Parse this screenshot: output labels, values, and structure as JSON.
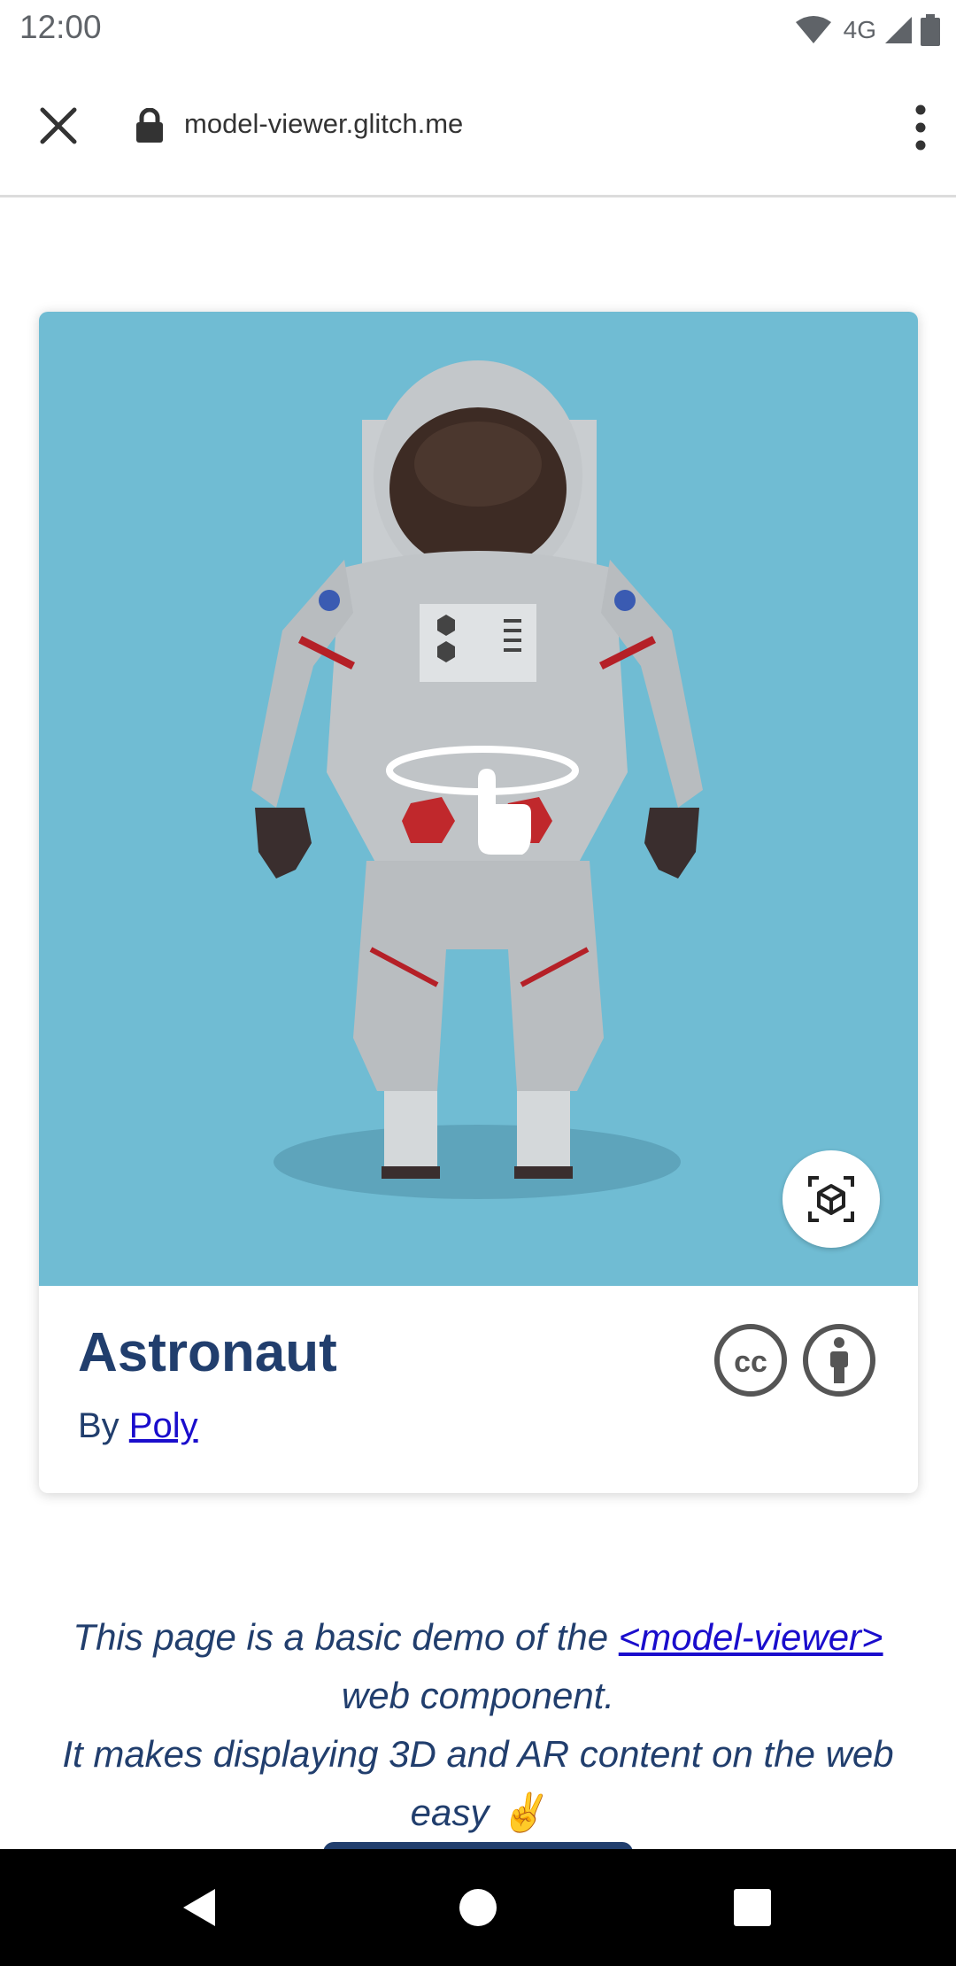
{
  "status_bar": {
    "time": "12:00",
    "network": "4G"
  },
  "browser": {
    "url": "model-viewer.glitch.me"
  },
  "card": {
    "title": "Astronaut",
    "by_prefix": "By ",
    "author": "Poly",
    "background_color": "#70bcd3"
  },
  "description": {
    "part1": "This page is a basic demo of the ",
    "link": "<model-viewer>",
    "part2": " web component.",
    "line2": "It makes displaying 3D and AR content on the web easy ",
    "emoji": "✌️"
  },
  "icons": [
    "wifi-icon",
    "signal-icon",
    "battery-icon",
    "close-icon",
    "lock-icon",
    "more-vert-icon",
    "rotate-gesture-icon",
    "ar-cube-icon",
    "cc-icon",
    "attribution-icon",
    "back-icon",
    "home-icon",
    "recents-icon"
  ]
}
